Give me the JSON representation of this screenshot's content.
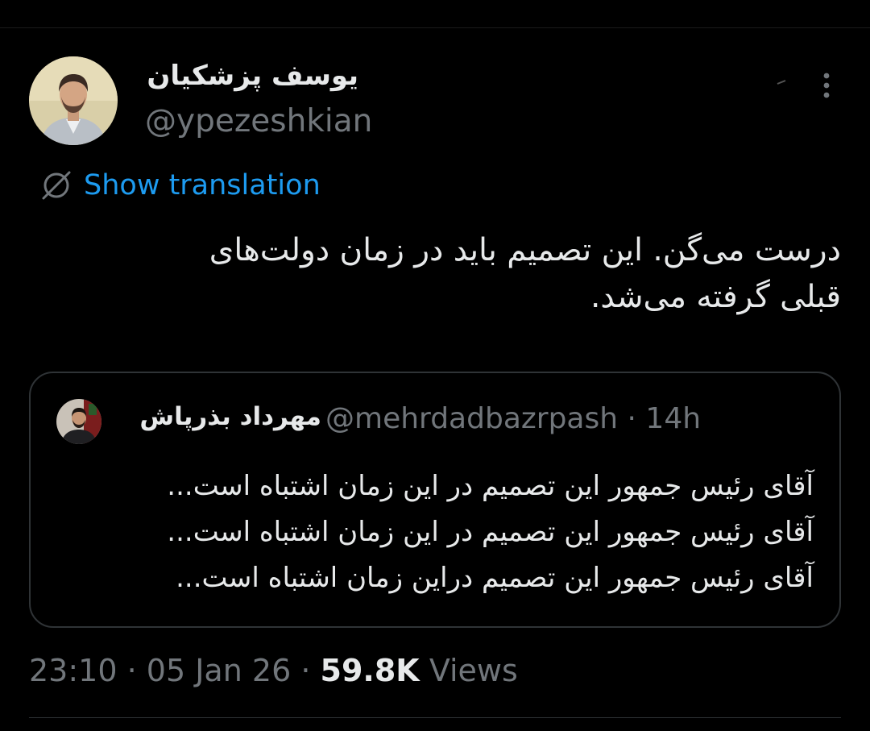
{
  "tweet": {
    "author_name": "یوسف پزشکیان",
    "author_handle": "@ypezeshkian",
    "avatar_icon": "profile-photo-icon",
    "more_icon": "more-vertical-icon",
    "translate_icon": "globe-slash-icon",
    "show_translation_label": "Show translation",
    "text_lines": [
      "درست می‌گن. این تصمیم باید در زمان دولت‌های",
      "قبلی گرفته می‌شد."
    ]
  },
  "quote": {
    "author_name": "مهرداد بذرپاش",
    "author_handle": "@mehrdadbazrpash",
    "separator": "·",
    "time_ago": "14h",
    "avatar_icon": "profile-photo-icon",
    "text_lines": [
      "آقای رئیس جمهور این تصمیم در این زمان اشتباه است...",
      "آقای رئیس جمهور این تصمیم در این زمان اشتباه است...",
      "آقای رئیس جمهور این تصمیم دراین زمان اشتباه است..."
    ]
  },
  "footer": {
    "time": "23:10",
    "separator1": "·",
    "date": "05 Jan 26",
    "separator2": "·",
    "views_count": "59.8K",
    "views_label": "Views"
  },
  "colors": {
    "background": "#000000",
    "text_primary": "#e7e9ea",
    "text_secondary": "#71767b",
    "link_blue": "#1d9bf0",
    "border": "#2f3336"
  }
}
